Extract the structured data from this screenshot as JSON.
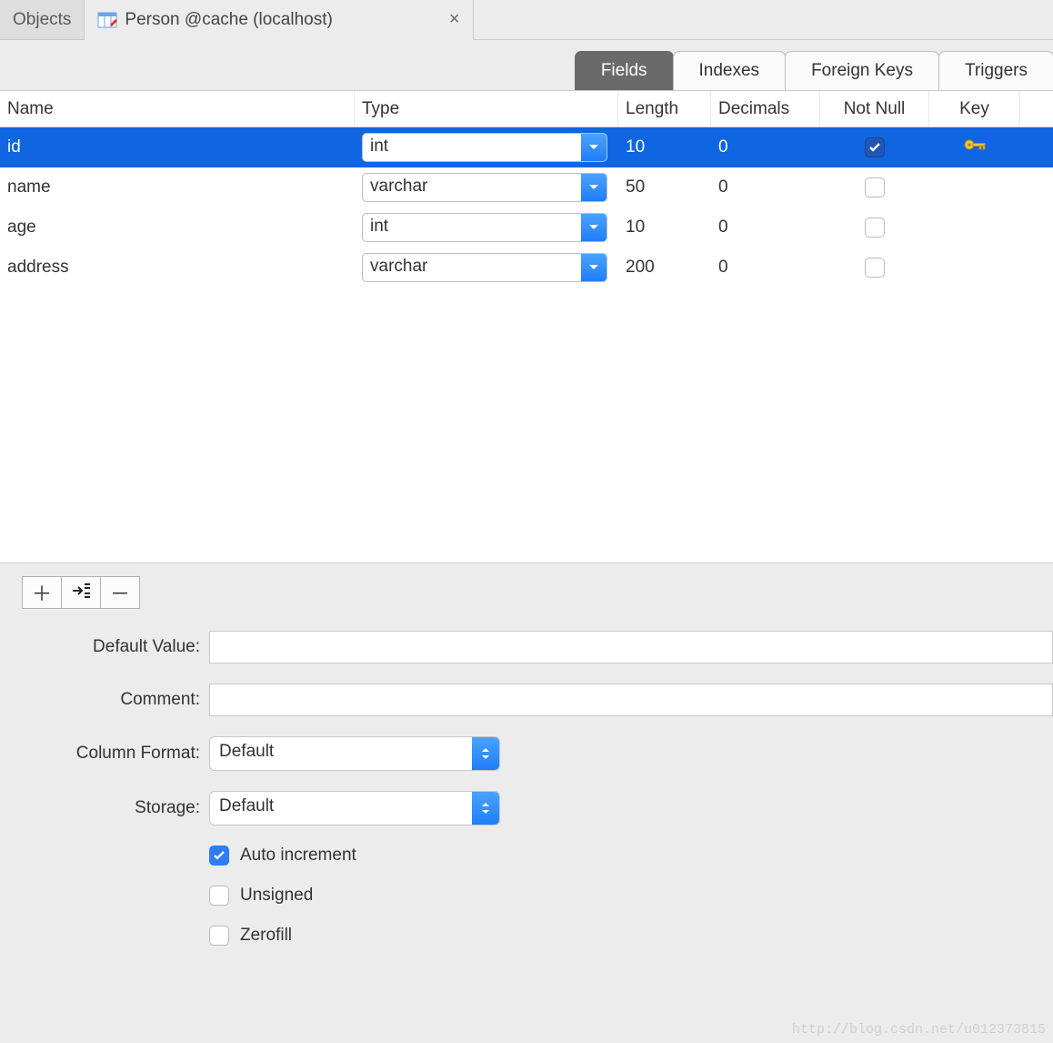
{
  "tabs": {
    "objects": "Objects",
    "active_title": "Person @cache (localhost)"
  },
  "sub_tabs": {
    "fields": "Fields",
    "indexes": "Indexes",
    "foreign_keys": "Foreign Keys",
    "triggers": "Triggers"
  },
  "columns": {
    "name": "Name",
    "type": "Type",
    "length": "Length",
    "decimals": "Decimals",
    "not_null": "Not Null",
    "key": "Key"
  },
  "rows": [
    {
      "name": "id",
      "type": "int",
      "length": "10",
      "decimals": "0",
      "not_null": true,
      "key": true
    },
    {
      "name": "name",
      "type": "varchar",
      "length": "50",
      "decimals": "0",
      "not_null": false,
      "key": false
    },
    {
      "name": "age",
      "type": "int",
      "length": "10",
      "decimals": "0",
      "not_null": false,
      "key": false
    },
    {
      "name": "address",
      "type": "varchar",
      "length": "200",
      "decimals": "0",
      "not_null": false,
      "key": false
    }
  ],
  "detail": {
    "default_value_label": "Default Value:",
    "default_value": "",
    "comment_label": "Comment:",
    "comment": "",
    "column_format_label": "Column Format:",
    "column_format_value": "Default",
    "storage_label": "Storage:",
    "storage_value": "Default",
    "auto_increment_label": "Auto increment",
    "auto_increment_checked": true,
    "unsigned_label": "Unsigned",
    "unsigned_checked": false,
    "zerofill_label": "Zerofill",
    "zerofill_checked": false
  },
  "watermark": "http://blog.csdn.net/u012373815"
}
